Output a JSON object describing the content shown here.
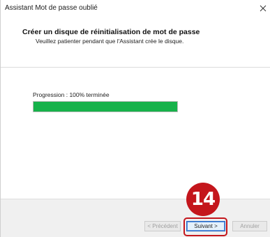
{
  "window": {
    "title": "Assistant Mot de passe oublié",
    "close_glyph": "✕"
  },
  "header": {
    "title": "Créer un disque de réinitialisation de mot de passe",
    "subtitle": "Veuillez patienter pendant que l'Assistant crée le disque."
  },
  "progress": {
    "label": "Progression : 100% terminée",
    "fraction": 1.0,
    "color": "#16b24a"
  },
  "buttons": {
    "previous": "< Précédent",
    "next": "Suivant >",
    "cancel": "Annuler"
  },
  "annotation": {
    "step_number": "14",
    "color": "#c4161c"
  }
}
